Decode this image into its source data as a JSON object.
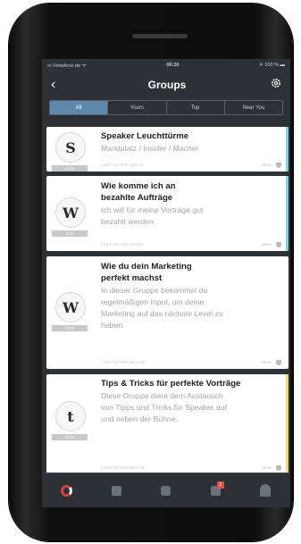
{
  "status": {
    "carrier": "•ıl Vodafone.de ᯤ",
    "time": "06:16",
    "battery": "✈ 100 % ▬"
  },
  "nav": {
    "title": "Groups"
  },
  "segments": [
    {
      "label": "All",
      "active": true
    },
    {
      "label": "Yours",
      "active": false
    },
    {
      "label": "Top",
      "active": false
    },
    {
      "label": "Near You",
      "active": false
    }
  ],
  "cards": [
    {
      "letter": "S",
      "badge": "JOIN",
      "title_lines": [
        "Speaker Leuchttürme"
      ],
      "desc_lines": [
        "Marktplatz / Insider / Macher"
      ],
      "footer": "LAST ACTIVE JAN 12",
      "more": "More",
      "accent": "#7fd3dc"
    },
    {
      "letter": "W",
      "badge": "JOIN",
      "title_lines": [
        "Wie komme ich an",
        "bezahlte Aufträge"
      ],
      "desc_lines": [
        "Ich will für meine Vorträge gut",
        "bezahlt werden."
      ],
      "footer": "LAST ACTIVE JAN 12",
      "more": "More",
      "accent": "#7fd3dc"
    },
    {
      "letter": "W",
      "badge": "JOIN",
      "title_lines": [
        "Wie du dein Marketing",
        "perfekt machst"
      ],
      "desc_lines": [
        "In dieser Gruppe bekommst du",
        "regelmäßigen Input, um deine",
        "Marketing auf das nächste Level zu",
        "heben."
      ],
      "footer": "LAST ACTIVE NOV 29",
      "more": "More",
      "accent": "#ffffff"
    },
    {
      "letter": "t",
      "badge": "JOIN",
      "title_lines": [
        "Tips & Tricks für perfekte Vorträge"
      ],
      "desc_lines": [
        "Diese Gruppe dient dem Austausch",
        "von Tipps und Tricks für Speaker auf",
        "und neben der Bühne."
      ],
      "footer": "LAST ACTIVE NOV 29",
      "more": "More",
      "accent": "#f4d57a"
    }
  ],
  "tabbar": {
    "notification_count": "2"
  }
}
